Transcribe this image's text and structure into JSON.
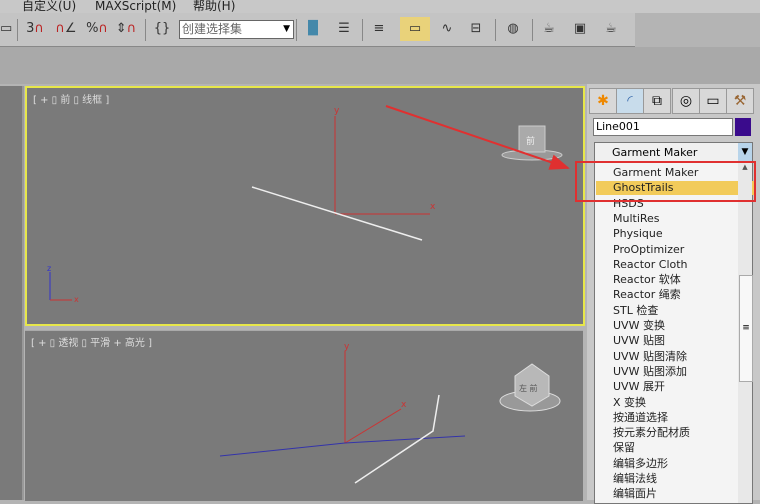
{
  "menu": [
    "自定义(U)",
    "MAXScript(M)",
    "帮助(H)"
  ],
  "toolbar": {
    "snap_3d": "3",
    "angle_snap": "∠",
    "percent_snap": "%",
    "spinner_snap": "⇕",
    "named_selection": "创建选择集",
    "edit_named": "{}"
  },
  "viewports": {
    "front_label": "[ + ▯ 前 ▯ 线框 ]",
    "persp_label": "[ + ▯ 透视 ▯ 平滑 + 高光 ]",
    "axis_x": "x",
    "axis_y": "y",
    "axis_z": "z",
    "viewcube_front": "前",
    "viewcube_persp": "左 前"
  },
  "panel": {
    "tabs": [
      "create-icon",
      "modify-icon",
      "hierarchy-icon",
      "motion-icon",
      "display-icon",
      "utilities-icon"
    ],
    "object_name": "Line001",
    "object_color": "#3a0b8c",
    "modifier_list_selected": "Garment Maker",
    "modifier_items": [
      "Garment Maker",
      "GhostTrails",
      "HSDS",
      "MultiRes",
      "Physique",
      "ProOptimizer",
      "Reactor Cloth",
      "Reactor 软体",
      "Reactor 绳索",
      "STL 检查",
      "UVW 变换",
      "UVW 贴图",
      "UVW 贴图清除",
      "UVW 贴图添加",
      "UVW 展开",
      "X 变换",
      "按通道选择",
      "按元素分配材质",
      "保留",
      "编辑多边形",
      "编辑法线",
      "编辑面片"
    ],
    "highlighted": "GhostTrails"
  },
  "colors": {
    "active_viewport": "#e7e74a",
    "highlight": "#f2cb5a",
    "annotation": "#e03030"
  }
}
